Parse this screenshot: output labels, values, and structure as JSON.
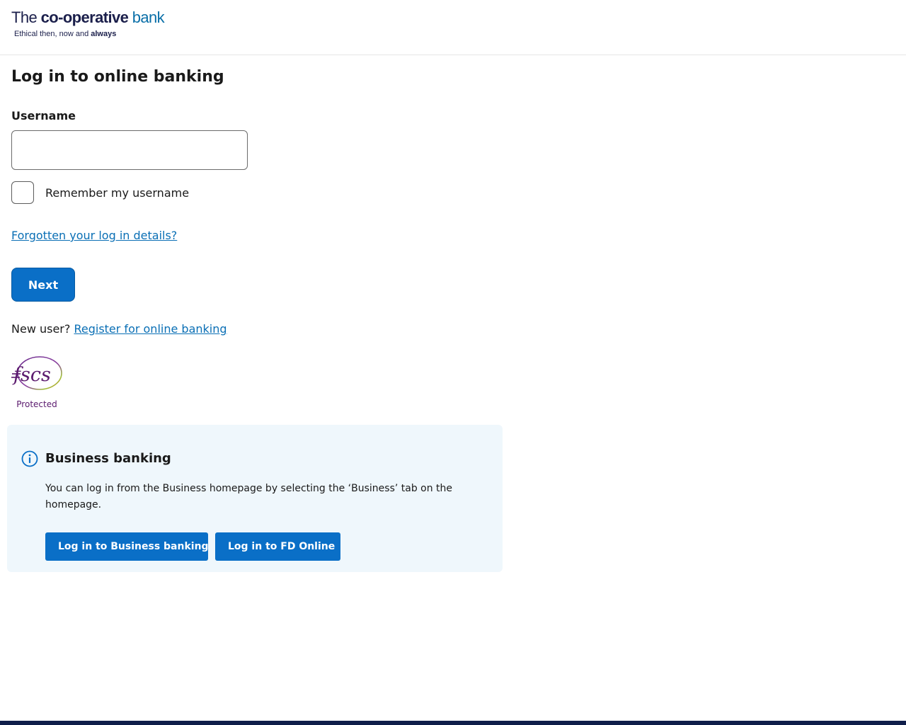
{
  "brand": {
    "name_prefix": "The ",
    "name_bold": "co-operative",
    "name_suffix": " bank",
    "tagline_prefix": "Ethical then, now and ",
    "tagline_bold": "always"
  },
  "login": {
    "title": "Log in to online banking",
    "username_label": "Username",
    "username_value": "",
    "remember_label": "Remember my username",
    "remember_checked": false,
    "forgot_link": "Forgotten your log in details?",
    "next_button": "Next",
    "new_user_text": "New user? ",
    "register_link": "Register for online banking"
  },
  "fscs": {
    "logo_text": "fscs",
    "protected_label": "Protected"
  },
  "business": {
    "title": "Business banking",
    "text": "You can log in from the Business homepage by selecting the ‘Business’ tab on the homepage.",
    "button_business": "Log in to Business banking",
    "button_fd": "Log in to FD Online"
  },
  "colors": {
    "primary": "#0a6fc7",
    "link": "#0a6fb5",
    "panel_bg": "#eff7fc",
    "brand_navy": "#1b1f4b",
    "footer": "#0f1e4a",
    "fscs_purple": "#5b1a6e"
  },
  "icons": {
    "info": "info-circle-icon"
  }
}
